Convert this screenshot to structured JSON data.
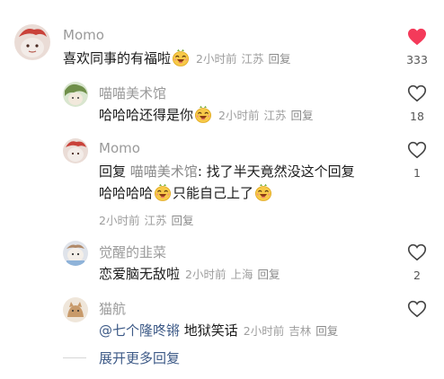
{
  "colors": {
    "liked_red": "#f43a5a",
    "link_blue": "#3d5a87",
    "meta_gray": "#9e9e9e"
  },
  "comments": [
    {
      "username": "Momo",
      "text": "喜欢同事的有福啦",
      "emoji": "laughing-emoji",
      "time": "2小时前",
      "location": "江苏",
      "reply_label": "回复",
      "likes": "333",
      "liked": true
    },
    {
      "username": "喵喵美术馆",
      "text": "哈哈哈还得是你",
      "emoji": "laughing-emoji",
      "time": "2小时前",
      "location": "江苏",
      "reply_label": "回复",
      "likes": "18",
      "liked": false
    },
    {
      "username": "Momo",
      "reply_prefix": "回复",
      "reply_to": "喵喵美术馆",
      "line1": ": 找了半天竟然没这个回复",
      "line2_a": "哈哈哈哈",
      "line2_b": "只能自己上了",
      "emoji": "laughing-emoji",
      "time": "2小时前",
      "location": "江苏",
      "reply_label": "回复",
      "likes": "1",
      "liked": false
    },
    {
      "username": "觉醒的韭菜",
      "text": "恋爱脑无敌啦",
      "time": "2小时前",
      "location": "上海",
      "reply_label": "回复",
      "likes": "2",
      "liked": false
    },
    {
      "username": "猫航",
      "mention": "@七个隆咚锵",
      "text": " 地狱笑话",
      "time": "2小时前",
      "location": "吉林",
      "reply_label": "回复",
      "likes": "",
      "liked": false
    }
  ],
  "expand_label": "展开更多回复"
}
